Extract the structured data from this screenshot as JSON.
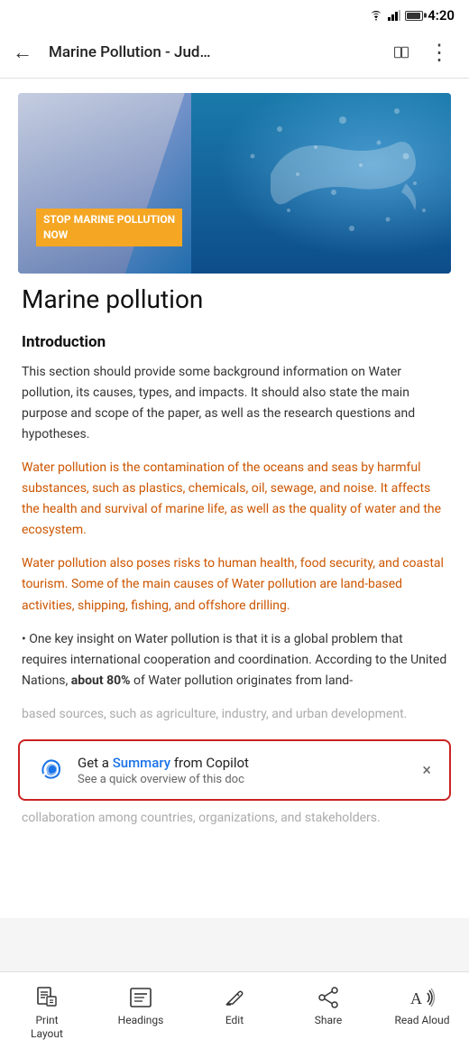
{
  "statusBar": {
    "time": "4:20"
  },
  "topBar": {
    "title": "Marine Pollution - Jud…",
    "backLabel": "←",
    "moreLabel": "⋮"
  },
  "hero": {
    "tagline1": "STOP MARINE POLLUTION",
    "tagline2": "NOW"
  },
  "document": {
    "mainTitle": "Marine pollution",
    "sectionTitle": "Introduction",
    "para1": "This section should provide some background information on Water pollution, its causes, types, and impacts. It should also state the main purpose and scope of the paper, as well as the research questions and hypotheses.",
    "para2orange": "Water pollution is the contamination of the oceans and seas by harmful substances, such as plastics, chemicals, oil, sewage, and noise. It affects the health and survival of marine life, as well as the quality of water and the ecosystem.",
    "para3orange": "Water pollution also poses risks to human health, food security, and coastal tourism. Some of the main causes of Water pollution are land-based activities, shipping, fishing, and offshore drilling.",
    "para4start": "• One key insight on Water pollution is that it is a global problem that requires international cooperation and coordination. According to the United Nations, ",
    "para4bold": "about 80%",
    "para4end": " of Water pollution originates from land-",
    "para4partial": "based sources, such as agriculture, industry, and urban development.",
    "afterBanner": "collaboration among countries, organizations, and stakeholders."
  },
  "copilotBanner": {
    "mainText1": "Get a ",
    "summaryLink": "Summary",
    "mainText2": " from Copilot",
    "subText": "See a quick overview of this doc",
    "closeLabel": "×"
  },
  "bottomToolbar": {
    "items": [
      {
        "id": "print-layout",
        "icon": "print-layout-icon",
        "label": "Print\nLayout"
      },
      {
        "id": "headings",
        "icon": "headings-icon",
        "label": "Headings"
      },
      {
        "id": "edit",
        "icon": "edit-icon",
        "label": "Edit"
      },
      {
        "id": "share",
        "icon": "share-icon",
        "label": "Share"
      },
      {
        "id": "read-aloud",
        "icon": "read-aloud-icon",
        "label": "Read Aloud"
      }
    ]
  }
}
